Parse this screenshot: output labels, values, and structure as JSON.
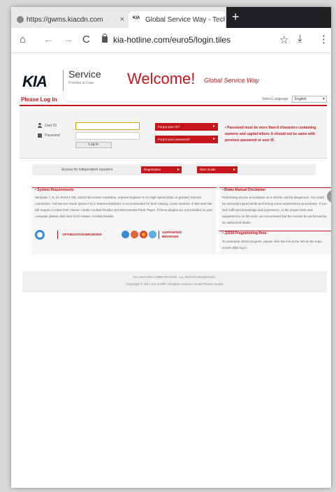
{
  "browser": {
    "tabs": [
      {
        "label": "https://gwms.kiacdn.com",
        "close": "×"
      },
      {
        "favicon": "KIA",
        "label": "Global Service Way - Technic",
        "close": "×"
      }
    ],
    "new_tab": "+",
    "nav": {
      "home": "⌂",
      "back": "←",
      "forward": "→",
      "reload": "C"
    },
    "url": "kia-hotline.com/euro5/login.tiles",
    "actions": {
      "star": "☆",
      "download": "⤓",
      "menu": "⋮"
    }
  },
  "header": {
    "logo_text": "KIA",
    "service_title": "Service",
    "service_sub": "Promise to Care",
    "welcome": "Welcome!",
    "welcome_sub": "Global Service Way"
  },
  "login": {
    "please_log_in": "Please Log In",
    "language_label": "Select Language",
    "language_value": "English",
    "user_id_label": "User ID",
    "password_label": "Password",
    "login_button": "Log In",
    "forgot_id": "Forgot your ID?",
    "forgot_password": "Forgot your password?",
    "password_note": "• Password must be more than 8 characters containing numeric and capital letters. It should not be same with previous password or user ID."
  },
  "independent": {
    "label": "Access for independent repairers",
    "registration": "Registration",
    "start_guide": "Start Guide"
  },
  "system": {
    "title": "• System Requirements",
    "text": "Windows 7, 8, 10: RAM 1 GB, 1024x768 screen resolution, Internet Explorer 9–11 High Speed (DSL or greater) Internet connection. Full Service Mode (press F11 in Internet Explorer) is recommended for best viewing. Some sections of this web site will require Acrobat SVG Viewer, Adobe Acrobat Reader and Macromedia Flash Player. If these plugins are not installed on your computer please click here SVG Viewer, Acrobat Reader.",
    "optimized": "OPTIMIZATION BROWSER",
    "supported": "SUPPORTED BROWSER"
  },
  "brake": {
    "title": "• Brake Manual Disclaimer",
    "text": "Performing service procedures on a vehicle can be dangerous. You could be seriously injured while performing some maintenance procedures. If you lack sufficient knowledge and experience, or the proper tools and equipment to do the work, we recommend that the service be performed by an authorized dealer."
  },
  "j2534": {
    "title": "• J2534 Programming Area",
    "text": "To download J2534 program, please click the link at the left on the main screen after log in."
  },
  "footer": {
    "line1": "KIA MOTORS CORPORATION. ALL RIGHTS RESERVED.",
    "line2": "Copyright © 2017 KIA CORP. All rights reserved. Email   Privacy Notice"
  },
  "colors": {
    "brand_red": "#c4161c",
    "kia_navy": "#05141f"
  }
}
